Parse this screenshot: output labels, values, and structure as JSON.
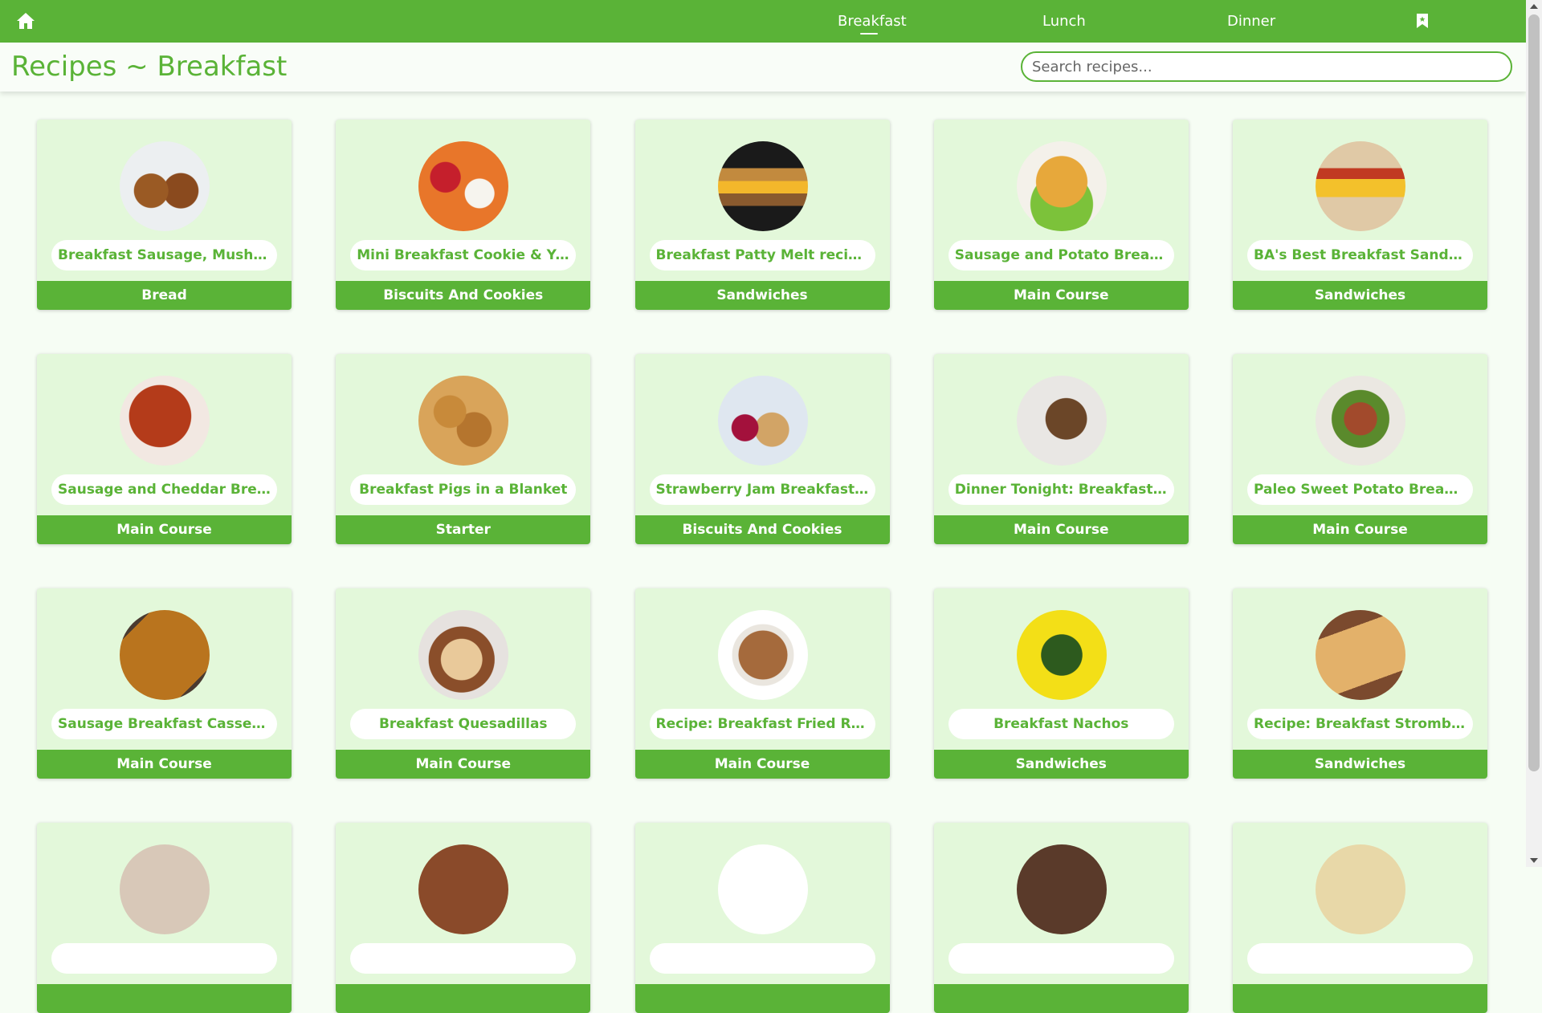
{
  "colors": {
    "brand_green": "#5ab337",
    "card_bg": "#e3f8da",
    "page_bg": "#f6fdf4"
  },
  "topbar": {
    "home_icon": "home-icon",
    "nav": [
      {
        "label": "Breakfast",
        "active": true
      },
      {
        "label": "Lunch",
        "active": false
      },
      {
        "label": "Dinner",
        "active": false
      }
    ],
    "bookmark_icon": "bookmark-icon"
  },
  "header": {
    "title": "Recipes ~ Breakfast",
    "search_placeholder": "Search recipes..."
  },
  "recipes": [
    {
      "title": "Breakfast Sausage, Mushroo...",
      "category": "Bread"
    },
    {
      "title": "Mini Breakfast Cookie & Yog...",
      "category": "Biscuits And Cookies"
    },
    {
      "title": "Breakfast Patty Melt recipes",
      "category": "Sandwiches"
    },
    {
      "title": "Sausage and Potato Breakfas...",
      "category": "Main Course"
    },
    {
      "title": "BA's Best Breakfast Sandwich",
      "category": "Sandwiches"
    },
    {
      "title": "Sausage and Cheddar Breakf...",
      "category": "Main Course"
    },
    {
      "title": "Breakfast Pigs in a Blanket",
      "category": "Starter"
    },
    {
      "title": "Strawberry Jam Breakfast Bi...",
      "category": "Biscuits And Cookies"
    },
    {
      "title": "Dinner Tonight: Breakfast Sa...",
      "category": "Main Course"
    },
    {
      "title": "Paleo Sweet Potato Breakfas...",
      "category": "Main Course"
    },
    {
      "title": "Sausage Breakfast Casserole",
      "category": "Main Course"
    },
    {
      "title": "Breakfast Quesadillas",
      "category": "Main Course"
    },
    {
      "title": "Recipe: Breakfast Fried Rice",
      "category": "Main Course"
    },
    {
      "title": "Breakfast Nachos",
      "category": "Sandwiches"
    },
    {
      "title": "Recipe: Breakfast Stromboli",
      "category": "Sandwiches"
    },
    {
      "title": "",
      "category": ""
    },
    {
      "title": "",
      "category": ""
    },
    {
      "title": "",
      "category": ""
    },
    {
      "title": "",
      "category": ""
    },
    {
      "title": "",
      "category": ""
    }
  ]
}
